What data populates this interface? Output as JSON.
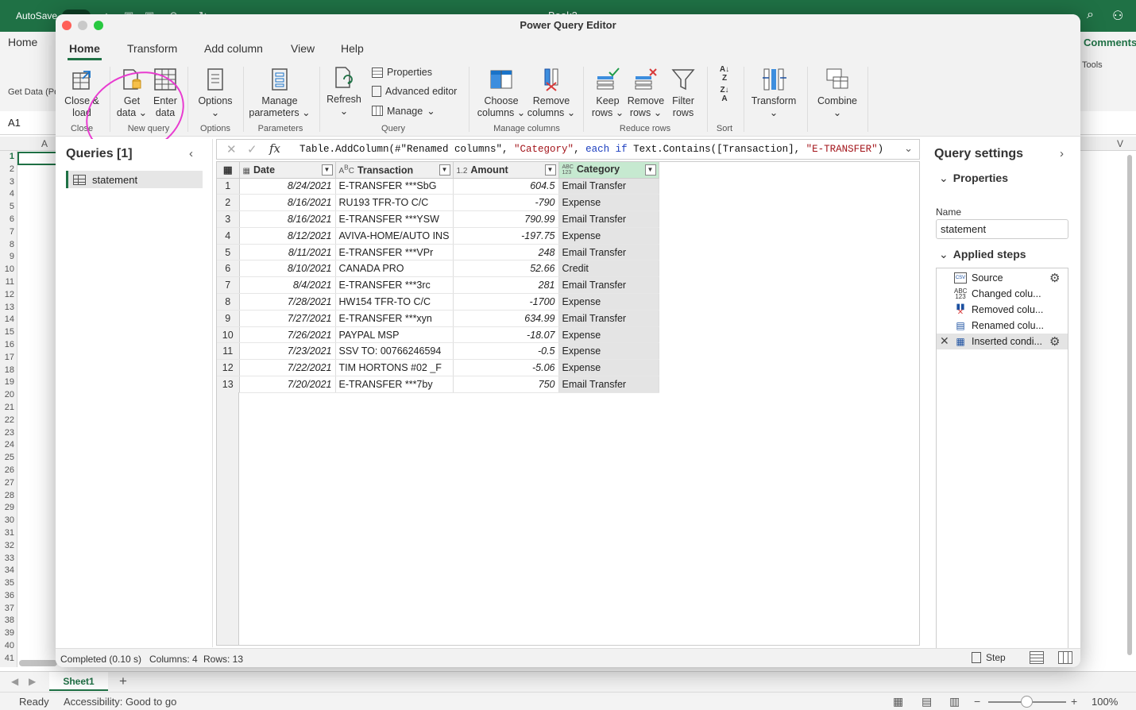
{
  "excel": {
    "autosave_label": "AutoSave",
    "book_title": "Book2",
    "home_tab": "Home",
    "get_data_label": "Get Data (Power Query)",
    "comments_label": "Comments",
    "tools_label": "Tools",
    "name_box": "A1",
    "col_a": "A",
    "col_v": "V",
    "rows": [
      "1",
      "2",
      "3",
      "4",
      "5",
      "6",
      "7",
      "8",
      "9",
      "10",
      "11",
      "12",
      "13",
      "14",
      "15",
      "16",
      "17",
      "18",
      "19",
      "20",
      "21",
      "22",
      "23",
      "24",
      "25",
      "26",
      "27",
      "28",
      "29",
      "30",
      "31",
      "32",
      "33",
      "34",
      "35",
      "36",
      "37",
      "38",
      "39",
      "40",
      "41"
    ],
    "sheet_tab": "Sheet1",
    "add_sheet": "+",
    "status_ready": "Ready",
    "status_accessibility": "Accessibility: Good to go",
    "zoom": "100%"
  },
  "window": {
    "title": "Power Query Editor",
    "tabs": [
      "Home",
      "Transform",
      "Add column",
      "View",
      "Help"
    ]
  },
  "ribbon": {
    "close_load": "Close & load",
    "get_data": "Get data",
    "enter_data": "Enter data",
    "options": "Options",
    "manage_parameters": "Manage parameters",
    "refresh": "Refresh",
    "properties": "Properties",
    "advanced_editor": "Advanced editor",
    "manage": "Manage",
    "choose_columns": "Choose columns",
    "remove_columns": "Remove columns",
    "keep_rows": "Keep rows",
    "remove_rows": "Remove rows",
    "filter_rows": "Filter rows",
    "transform": "Transform",
    "combine": "Combine",
    "groups": {
      "close": "Close",
      "new_query": "New query",
      "options": "Options",
      "parameters": "Parameters",
      "query": "Query",
      "manage_columns": "Manage columns",
      "reduce_rows": "Reduce rows",
      "sort": "Sort"
    }
  },
  "formula": {
    "p1": "Table.AddColumn(#\"Renamed columns\", ",
    "s1": "\"Category\"",
    "p2": ", ",
    "k1": "each if",
    "p3": " Text.Contains([Transaction], ",
    "s2": "\"E-TRANSFER\"",
    "p4": ")"
  },
  "queries": {
    "title": "Queries [1]",
    "items": [
      "statement"
    ]
  },
  "table": {
    "columns": [
      {
        "type": "date",
        "name": "Date"
      },
      {
        "type": "text",
        "name": "Transaction"
      },
      {
        "type": "1.2",
        "name": "Amount"
      },
      {
        "type": "ABC/123",
        "name": "Category"
      }
    ],
    "rows": [
      [
        "1",
        "8/24/2021",
        "E-TRANSFER ***SbG",
        "604.5",
        "Email Transfer"
      ],
      [
        "2",
        "8/16/2021",
        "RU193 TFR-TO C/C",
        "-790",
        "Expense"
      ],
      [
        "3",
        "8/16/2021",
        "E-TRANSFER ***YSW",
        "790.99",
        "Email Transfer"
      ],
      [
        "4",
        "8/12/2021",
        "AVIVA-HOME/AUTO INS",
        "-197.75",
        "Expense"
      ],
      [
        "5",
        "8/11/2021",
        " E-TRANSFER ***VPr",
        "248",
        "Email Transfer"
      ],
      [
        "6",
        "8/10/2021",
        "CANADA PRO",
        "52.66",
        "Credit"
      ],
      [
        "7",
        "8/4/2021",
        "E-TRANSFER ***3rc",
        "281",
        "Email Transfer"
      ],
      [
        "8",
        "7/28/2021",
        "HW154 TFR-TO C/C",
        "-1700",
        "Expense"
      ],
      [
        "9",
        "7/27/2021",
        " E-TRANSFER ***xyn",
        "634.99",
        "Email Transfer"
      ],
      [
        "10",
        "7/26/2021",
        "PAYPAL MSP",
        "-18.07",
        "Expense"
      ],
      [
        "11",
        "7/23/2021",
        "SSV TO: 00766246594",
        "-0.5",
        "Expense"
      ],
      [
        "12",
        "7/22/2021",
        "TIM HORTONS #02 _F",
        "-5.06",
        "Expense"
      ],
      [
        "13",
        "7/20/2021",
        " E-TRANSFER ***7by",
        "750",
        "Email Transfer"
      ]
    ]
  },
  "settings": {
    "title": "Query settings",
    "properties": "Properties",
    "name_label": "Name",
    "name_value": "statement",
    "applied_steps": "Applied steps",
    "steps": [
      "Source",
      "Changed colu...",
      "Removed colu...",
      "Renamed colu...",
      "Inserted condi..."
    ]
  },
  "status": {
    "completed": "Completed (0.10 s)",
    "columns": "Columns: 4",
    "rows": "Rows: 13",
    "step": "Step"
  }
}
